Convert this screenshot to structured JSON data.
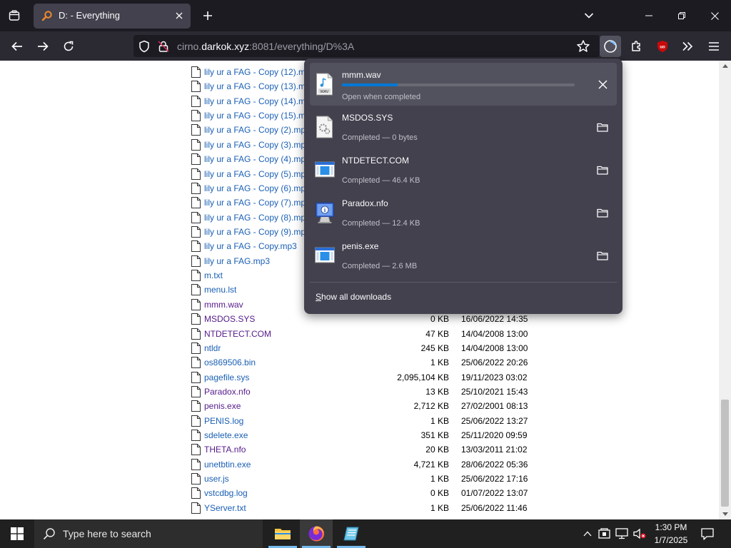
{
  "browser": {
    "tab": {
      "title": "D: - Everything"
    },
    "url": {
      "prefix": "cirno.",
      "host": "darkok.xyz",
      "rest": ":8081/everything/D%3A"
    }
  },
  "files": [
    {
      "name": "lily ur a FAG - Copy (12).m",
      "size": "",
      "date": "",
      "visited": false
    },
    {
      "name": "lily ur a FAG - Copy (13).m",
      "size": "",
      "date": "",
      "visited": false
    },
    {
      "name": "lily ur a FAG - Copy (14).m",
      "size": "",
      "date": "",
      "visited": false
    },
    {
      "name": "lily ur a FAG - Copy (15).m",
      "size": "",
      "date": "",
      "visited": false
    },
    {
      "name": "lily ur a FAG - Copy (2).mp",
      "size": "",
      "date": "",
      "visited": false
    },
    {
      "name": "lily ur a FAG - Copy (3).mp",
      "size": "",
      "date": "",
      "visited": false
    },
    {
      "name": "lily ur a FAG - Copy (4).mp",
      "size": "",
      "date": "",
      "visited": false
    },
    {
      "name": "lily ur a FAG - Copy (5).mp",
      "size": "",
      "date": "",
      "visited": false
    },
    {
      "name": "lily ur a FAG - Copy (6).mp",
      "size": "",
      "date": "",
      "visited": false
    },
    {
      "name": "lily ur a FAG - Copy (7).mp",
      "size": "",
      "date": "",
      "visited": false
    },
    {
      "name": "lily ur a FAG - Copy (8).mp",
      "size": "",
      "date": "",
      "visited": false
    },
    {
      "name": "lily ur a FAG - Copy (9).mp",
      "size": "",
      "date": "",
      "visited": false
    },
    {
      "name": "lily ur a FAG - Copy.mp3",
      "size": "",
      "date": "",
      "visited": false
    },
    {
      "name": "lily ur a FAG.mp3",
      "size": "",
      "date": "",
      "visited": false
    },
    {
      "name": "m.txt",
      "size": "",
      "date": "",
      "visited": false
    },
    {
      "name": "menu.lst",
      "size": "",
      "date": "",
      "visited": false
    },
    {
      "name": "mmm.wav",
      "size": "",
      "date": "",
      "visited": true
    },
    {
      "name": "MSDOS.SYS",
      "size": "0 KB",
      "date": "16/06/2022 14:35",
      "visited": true
    },
    {
      "name": "NTDETECT.COM",
      "size": "47 KB",
      "date": "14/04/2008 13:00",
      "visited": true
    },
    {
      "name": "ntldr",
      "size": "245 KB",
      "date": "14/04/2008 13:00",
      "visited": false
    },
    {
      "name": "os869506.bin",
      "size": "1 KB",
      "date": "25/06/2022 20:26",
      "visited": false
    },
    {
      "name": "pagefile.sys",
      "size": "2,095,104 KB",
      "date": "19/11/2023 03:02",
      "visited": false
    },
    {
      "name": "Paradox.nfo",
      "size": "13 KB",
      "date": "25/10/2021 15:43",
      "visited": true
    },
    {
      "name": "penis.exe",
      "size": "2,712 KB",
      "date": "27/02/2001 08:13",
      "visited": true
    },
    {
      "name": "PENIS.log",
      "size": "1 KB",
      "date": "25/06/2022 13:27",
      "visited": false
    },
    {
      "name": "sdelete.exe",
      "size": "351 KB",
      "date": "25/11/2020 09:59",
      "visited": false
    },
    {
      "name": "THETA.nfo",
      "size": "20 KB",
      "date": "13/03/2011 21:02",
      "visited": true
    },
    {
      "name": "unetbtin.exe",
      "size": "4,721 KB",
      "date": "28/06/2022 05:36",
      "visited": false
    },
    {
      "name": "user.js",
      "size": "1 KB",
      "date": "25/06/2022 17:16",
      "visited": false
    },
    {
      "name": "vstcdbg.log",
      "size": "0 KB",
      "date": "01/07/2022 13:07",
      "visited": false
    },
    {
      "name": "YServer.txt",
      "size": "1 KB",
      "date": "25/06/2022 11:46",
      "visited": false
    }
  ],
  "downloads": {
    "items": [
      {
        "name": "mmm.wav",
        "status": "Open when completed",
        "icon": "wav-file-icon",
        "in_progress": true,
        "progress": 0.24,
        "action": "cancel"
      },
      {
        "name": "MSDOS.SYS",
        "status": "Completed — 0 bytes",
        "icon": "system-file-icon",
        "in_progress": false,
        "action": "show-in-folder"
      },
      {
        "name": "NTDETECT.COM",
        "status": "Completed — 46.4 KB",
        "icon": "executable-file-icon",
        "in_progress": false,
        "action": "show-in-folder"
      },
      {
        "name": "Paradox.nfo",
        "status": "Completed — 12.4 KB",
        "icon": "info-file-icon",
        "in_progress": false,
        "action": "show-in-folder"
      },
      {
        "name": "penis.exe",
        "status": "Completed — 2.6 MB",
        "icon": "executable-file-icon",
        "in_progress": false,
        "action": "show-in-folder"
      }
    ],
    "show_all_label": "Show all downloads"
  },
  "taskbar": {
    "search_placeholder": "Type here to search",
    "time": "1:30 PM",
    "date": "1/7/2025"
  },
  "colors": {
    "accent": "#0078d4",
    "link": "#1a5fb4",
    "visited_link": "#551a8b",
    "panel_bg": "#42414d"
  }
}
